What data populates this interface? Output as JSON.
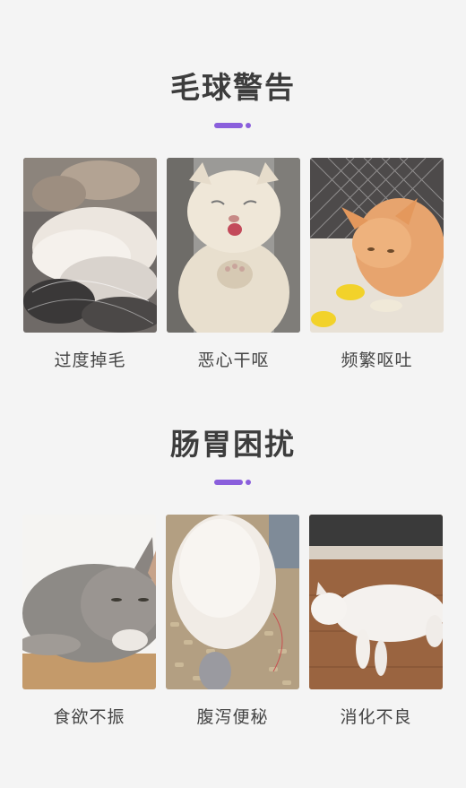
{
  "accent": "#8a5fdc",
  "sections": [
    {
      "title": "毛球警告",
      "cards": [
        {
          "caption": "过度掉毛",
          "image": "shed-fur-clump-photo"
        },
        {
          "caption": "恶心干呕",
          "image": "retching-white-cat-photo"
        },
        {
          "caption": "频繁呕吐",
          "image": "vomiting-orange-cat-photo"
        }
      ]
    },
    {
      "title": "肠胃困扰",
      "cards": [
        {
          "caption": "食欲不振",
          "image": "lethargic-grey-cat-photo"
        },
        {
          "caption": "腹泻便秘",
          "image": "cat-in-litter-photo"
        },
        {
          "caption": "消化不良",
          "image": "white-cat-lying-photo"
        }
      ]
    }
  ]
}
